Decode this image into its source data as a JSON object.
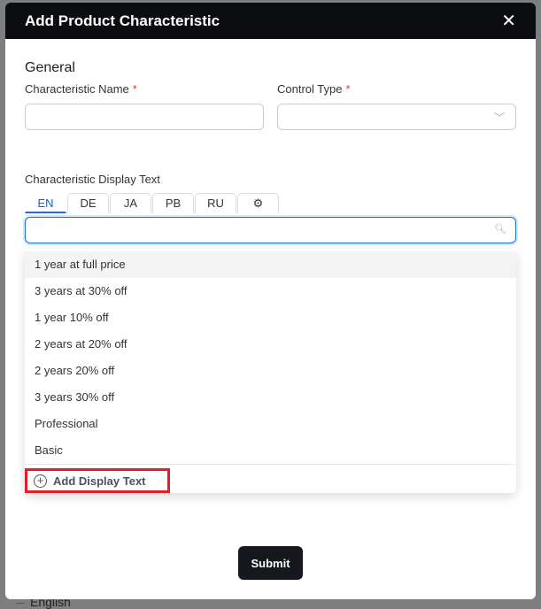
{
  "background": {
    "text": "English"
  },
  "modal": {
    "title": "Add Product Characteristic",
    "close_icon": "close-icon",
    "section": "General",
    "name_label": "Characteristic Name",
    "control_label": "Control Type",
    "required_mark": "*",
    "display_text_label": "Characteristic Display Text",
    "tabs": [
      "EN",
      "DE",
      "JA",
      "PB",
      "RU"
    ],
    "active_tab": "EN",
    "settings_icon": "gear-icon",
    "search_icon": "search-icon",
    "options": [
      "1 year at full price",
      "3 years at 30% off",
      "1 year 10% off",
      "2 years at 20% off",
      "2 years 20% off",
      "3 years 30% off",
      "Professional",
      "Basic"
    ],
    "add_label": "Add Display Text",
    "submit": "Submit",
    "accent": "#1e6fd9",
    "highlight": "#e41e2b"
  }
}
